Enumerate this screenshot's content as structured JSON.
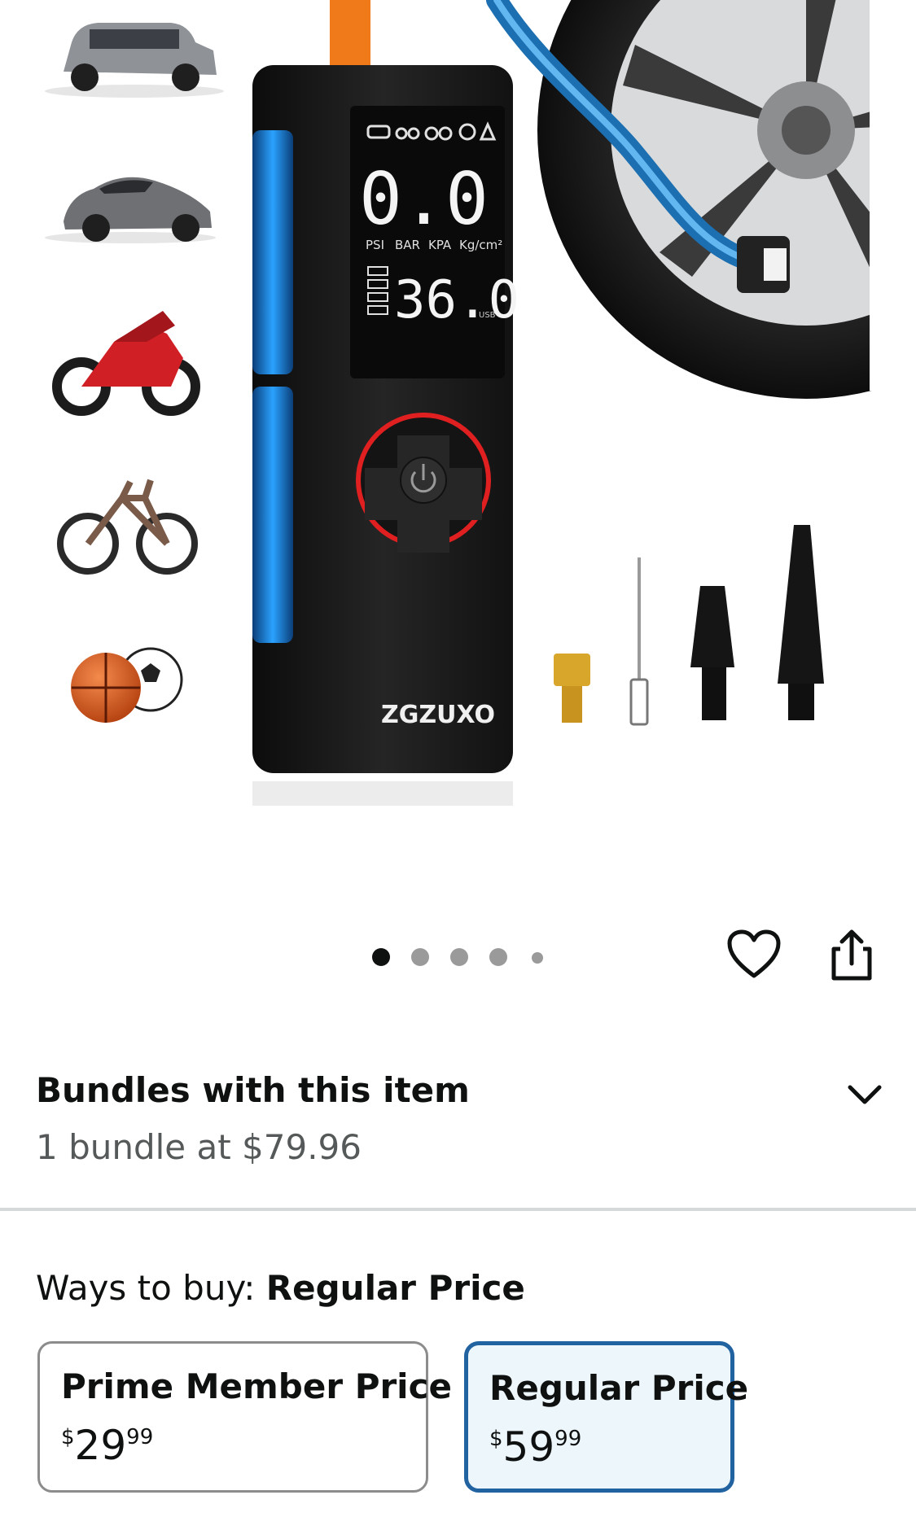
{
  "product_image": {
    "brand": "ZGZUXO",
    "display_main": "0.0",
    "display_units": [
      "PSI",
      "BAR",
      "KPA",
      "Kg/cm²"
    ],
    "display_battery": "36.0",
    "display_usb": "USB",
    "mode_icons": [
      "car-icon",
      "motorcycle-icon",
      "bicycle-icon",
      "ball-icon",
      "pressure-icon"
    ]
  },
  "carousel": {
    "total": 5,
    "active_index": 0
  },
  "actions": {
    "favorite_icon": "heart-icon",
    "share_icon": "share-icon"
  },
  "bundles": {
    "title": "Bundles with this item",
    "subtitle": "1 bundle at $79.96"
  },
  "ways_to_buy": {
    "prefix": "Ways to buy:",
    "selected": "Regular Price",
    "options": [
      {
        "name": "Prime Member Price",
        "currency": "$",
        "whole": "29",
        "fraction": "99",
        "selected": false
      },
      {
        "name": "Regular Price",
        "currency": "$",
        "whole": "59",
        "fraction": "99",
        "selected": true
      }
    ]
  },
  "colors": {
    "selected_border": "#2162a1",
    "selected_bg": "#edf6fb",
    "device_red": "#e02020",
    "device_blue": "#1e8fe6",
    "hose_orange": "#f07a1a"
  }
}
